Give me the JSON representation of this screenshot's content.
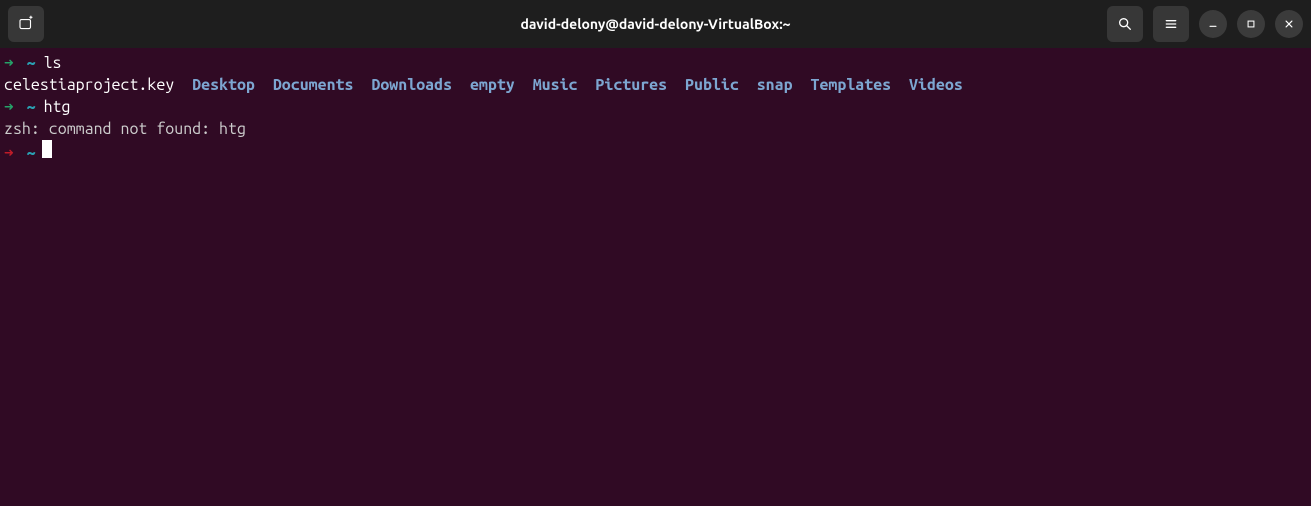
{
  "titlebar": {
    "title": "david-delony@david-delony-VirtualBox:~"
  },
  "prompts": {
    "arrow": "➜",
    "tilde": "~"
  },
  "lines": {
    "cmd1": "ls",
    "ls_output": {
      "file1": "celestiaproject.key",
      "dirs": [
        "Desktop",
        "Documents",
        "Downloads",
        "empty",
        "Music",
        "Pictures",
        "Public",
        "snap",
        "Templates",
        "Videos"
      ]
    },
    "cmd2": "htg",
    "error": "zsh: command not found: htg"
  }
}
